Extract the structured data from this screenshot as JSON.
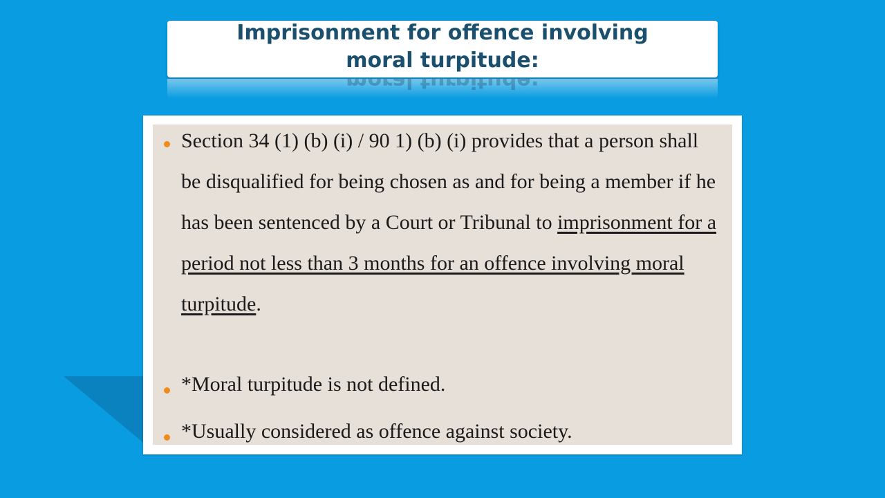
{
  "title": {
    "line1": "Imprisonment for offence involving",
    "line2": "moral turpitude:"
  },
  "bullets": [
    {
      "plain": "Section 34 (1) (b) (i) / 90 1) (b) (i) provides that a person shall be disqualified for being chosen as and for being a member if he has been sentenced by a Court or Tribunal to ",
      "underlined": "imprisonment for a period not less than 3 months for an offence involving moral turpitude",
      "end": "."
    },
    {
      "text": "*Moral turpitude is not defined."
    },
    {
      "text": "*Usually considered as offence against society."
    }
  ],
  "colors": {
    "background": "#0a9ce0",
    "title_text": "#1b4f6e",
    "content_panel": "#e7e0d8",
    "bullet": "#f08a1c"
  }
}
